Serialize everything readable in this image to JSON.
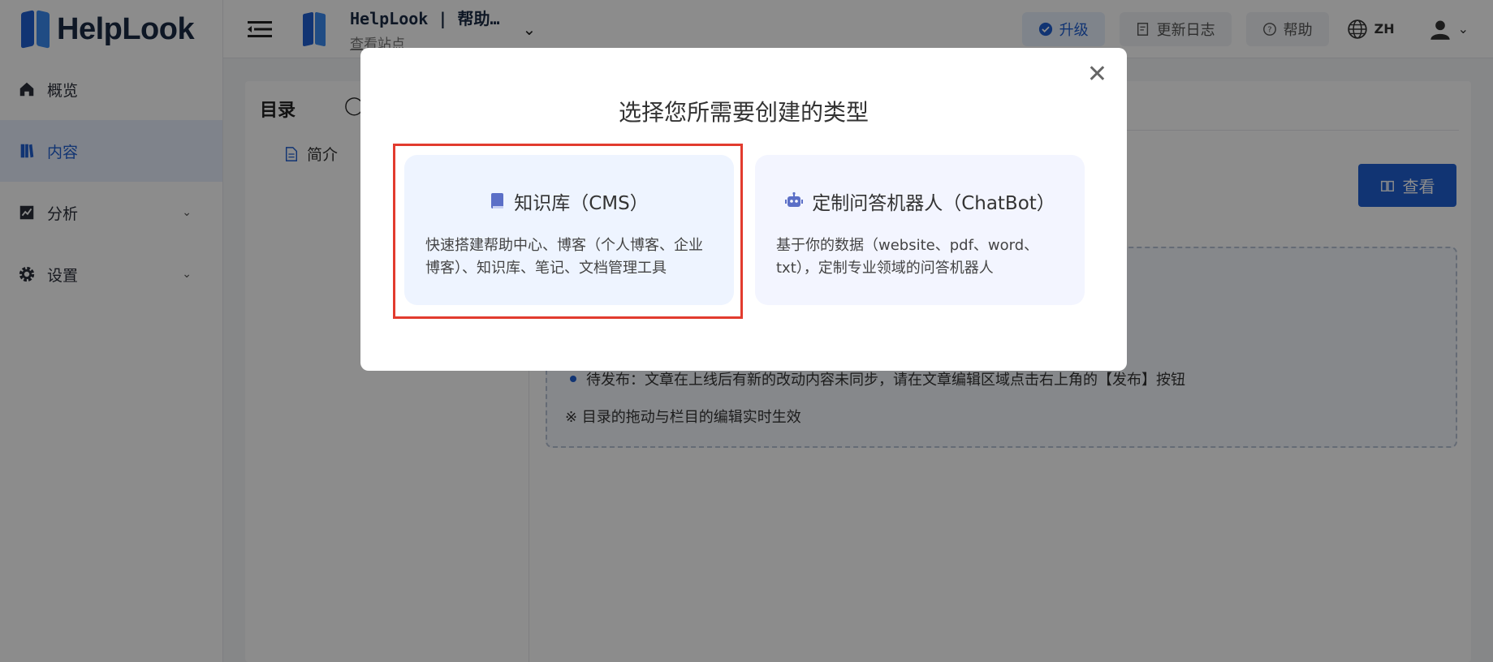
{
  "brand": "HelpLook",
  "sidebar": {
    "items": [
      {
        "label": "概览",
        "icon": "home-icon"
      },
      {
        "label": "内容",
        "icon": "book-icon",
        "active": true
      },
      {
        "label": "分析",
        "icon": "chart-icon",
        "expandable": true
      },
      {
        "label": "设置",
        "icon": "gear-icon",
        "expandable": true
      }
    ]
  },
  "topbar": {
    "site_title": "HelpLook | 帮助…",
    "site_sub": "查看站点",
    "upgrade": "升级",
    "changelog": "更新日志",
    "help": "帮助",
    "lang": "ZH"
  },
  "content": {
    "toc_title": "目录",
    "toc_item": "简介",
    "view_button": "查看",
    "status_line": "待发布：文章在上线后有新的改动内容未同步，请在文章编辑区域点击右上角的【发布】按钮",
    "note_line": "※ 目录的拖动与栏目的编辑实时生效"
  },
  "modal": {
    "title": "选择您所需要创建的类型",
    "cards": [
      {
        "title": "知识库（CMS）",
        "desc": "快速搭建帮助中心、博客（个人博客、企业博客）、知识库、笔记、文档管理工具"
      },
      {
        "title": "定制问答机器人（ChatBot）",
        "desc": "基于你的数据（website、pdf、word、txt），定制专业领域的问答机器人"
      }
    ]
  },
  "colors": {
    "accent": "#1f5fd1",
    "highlight": "#e23b2e"
  }
}
